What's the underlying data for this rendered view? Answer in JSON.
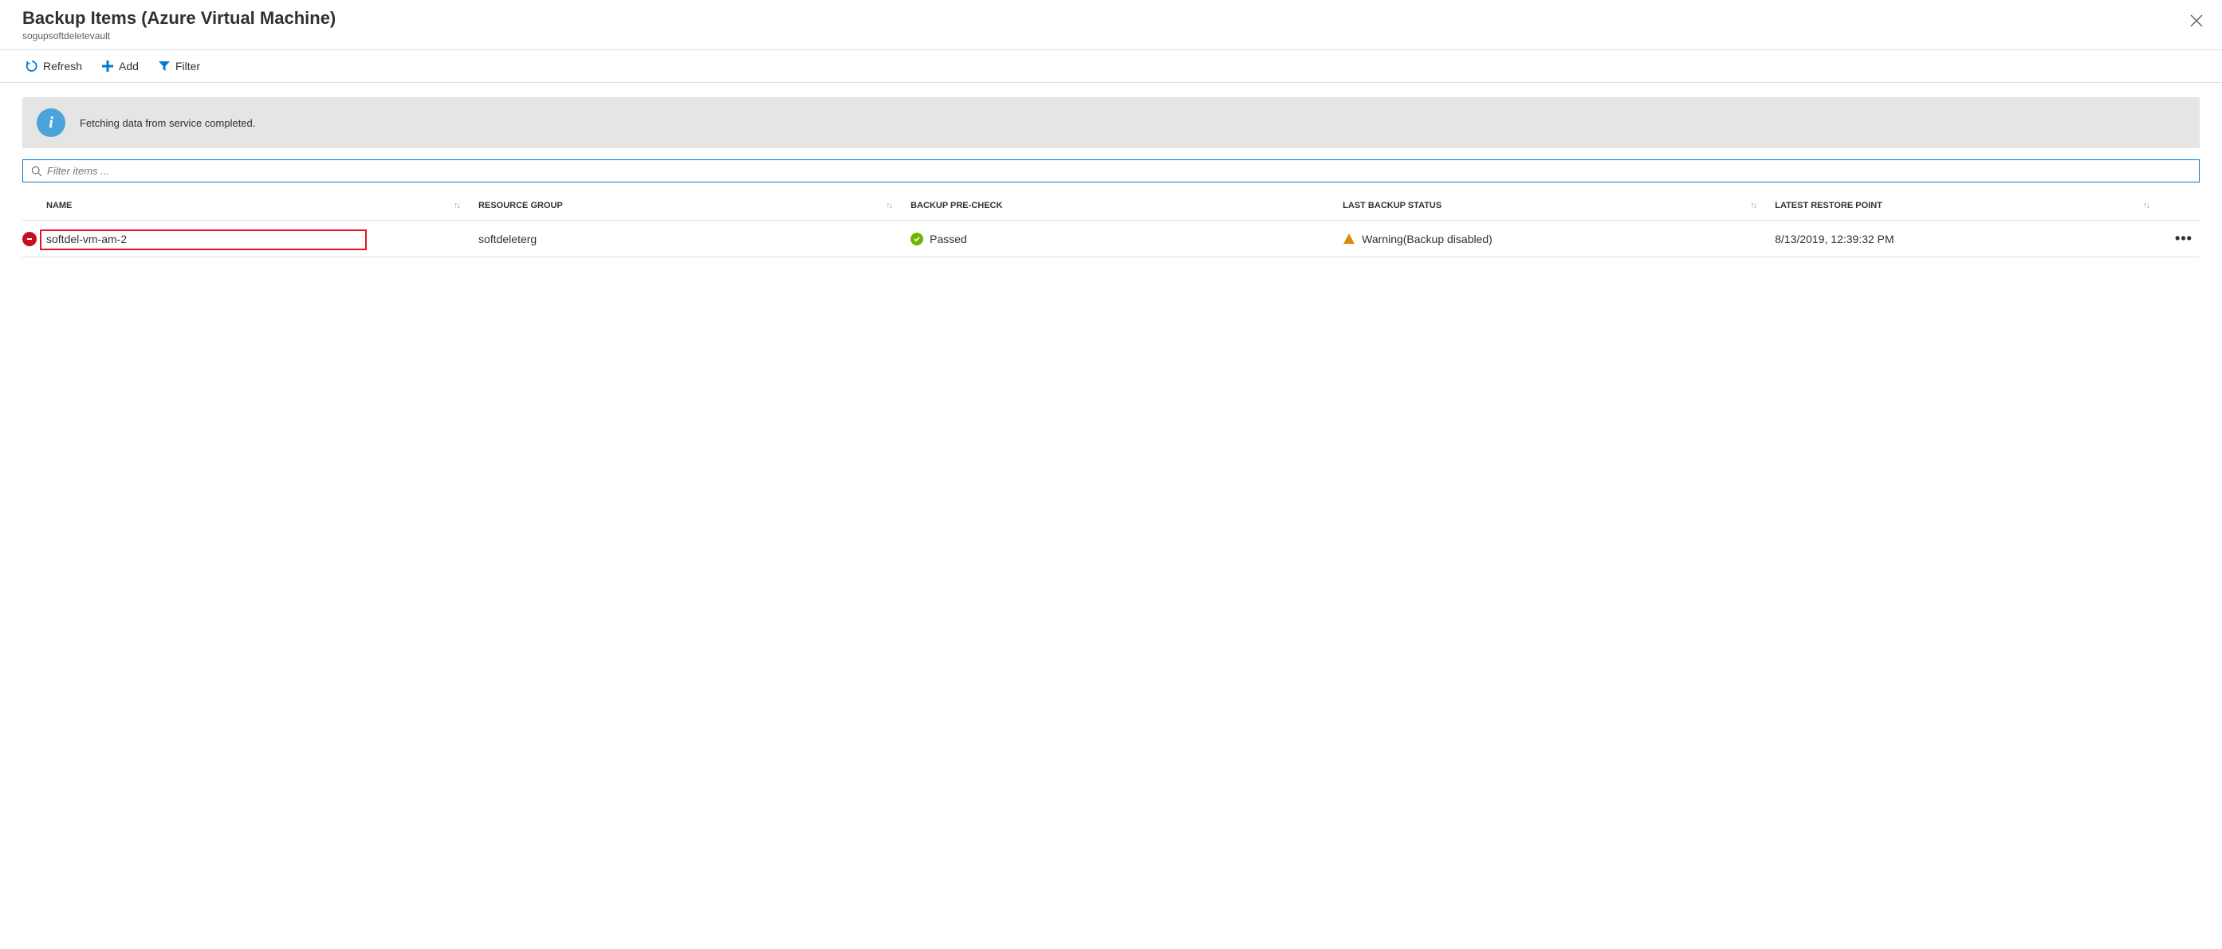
{
  "header": {
    "title": "Backup Items (Azure Virtual Machine)",
    "subtitle": "sogupsoftdeletevault"
  },
  "commands": {
    "refresh": "Refresh",
    "add": "Add",
    "filter": "Filter"
  },
  "info_message": "Fetching data from service completed.",
  "search": {
    "placeholder": "Filter items ..."
  },
  "columns": {
    "name": "NAME",
    "resource_group": "RESOURCE GROUP",
    "backup_precheck": "BACKUP PRE-CHECK",
    "last_backup_status": "LAST BACKUP STATUS",
    "latest_restore_point": "LATEST RESTORE POINT"
  },
  "rows": [
    {
      "name": "softdel-vm-am-2",
      "resource_group": "softdeleterg",
      "precheck": "Passed",
      "status": "Warning(Backup disabled)",
      "restore_point": "8/13/2019, 12:39:32 PM"
    }
  ]
}
